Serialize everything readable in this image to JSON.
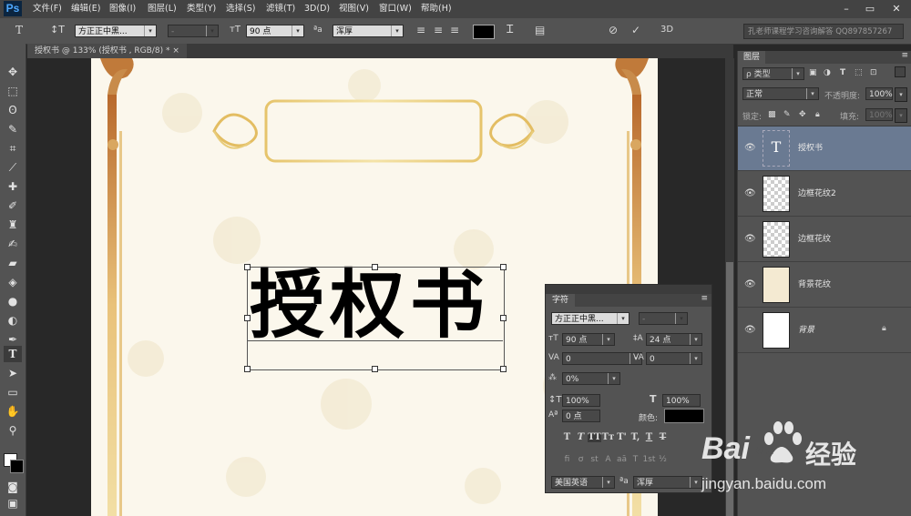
{
  "app": {
    "logo": "Ps"
  },
  "menu": [
    "文件(F)",
    "编辑(E)",
    "图像(I)",
    "图层(L)",
    "类型(Y)",
    "选择(S)",
    "滤镜(T)",
    "3D(D)",
    "视图(V)",
    "窗口(W)",
    "帮助(H)"
  ],
  "window_controls": {
    "minimize": "–",
    "restore": "▭",
    "close": "✕"
  },
  "options": {
    "font_family": "方正正中黑...",
    "font_style": "-",
    "font_size": "90 点",
    "aa_label": "ªa",
    "antialias": "浑厚",
    "threeD": "3D",
    "hint": "孔老师课程学习咨询解答 QQ897857267"
  },
  "document": {
    "tab_title": "授权书 @ 133% (授权书 , RGB/8) *",
    "tab_close": "×",
    "title_text": "授权书"
  },
  "character_panel": {
    "title": "字符",
    "font_family": "方正正中黑...",
    "font_style": "-",
    "font_size": "90 点",
    "leading": "24 点",
    "kerning": "0",
    "tracking": "0",
    "tsume": "0%",
    "vertical_scale": "100%",
    "horizontal_scale": "100%",
    "baseline_shift": "0 点",
    "color_label": "颜色:",
    "style_buttons": [
      "T",
      "T",
      "TT",
      "Tт",
      "T'",
      "T,",
      "T",
      "T"
    ],
    "opentype_buttons": [
      "fi",
      "ơ",
      "st",
      "A",
      "aā",
      "T",
      "1st",
      "½"
    ],
    "language": "美国英语",
    "aa_label": "ªa",
    "antialias": "浑厚"
  },
  "layers_panel": {
    "title": "图层",
    "filter": "ρ 类型",
    "blend_mode": "正常",
    "opacity_label": "不透明度:",
    "opacity": "100%",
    "lock_label": "锁定:",
    "fill_label": "填充:",
    "fill": "100%",
    "layers": [
      {
        "name": "授权书",
        "type": "text",
        "selected": true
      },
      {
        "name": "边框花纹2",
        "type": "transparent",
        "selected": false
      },
      {
        "name": "边框花纹",
        "type": "transparent",
        "selected": false
      },
      {
        "name": "背景花纹",
        "type": "pattern",
        "selected": false
      },
      {
        "name": "背景",
        "type": "white",
        "selected": false,
        "locked": true
      }
    ]
  },
  "watermark": {
    "brand": "Bai",
    "brand2": "du",
    "product": "经验",
    "url": "jingyan.baidu.com"
  },
  "colors": {
    "selected_layer": "#6a7a92",
    "panel": "#535353",
    "frame_gold": "#c8893a",
    "text_color": "#000000"
  }
}
